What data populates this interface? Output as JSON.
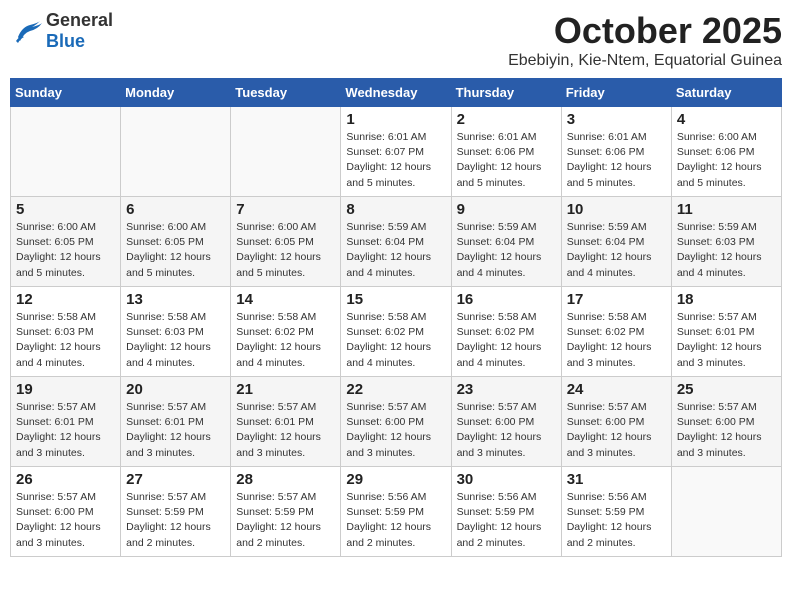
{
  "header": {
    "logo_general": "General",
    "logo_blue": "Blue",
    "month": "October 2025",
    "location": "Ebebiyin, Kie-Ntem, Equatorial Guinea"
  },
  "days_of_week": [
    "Sunday",
    "Monday",
    "Tuesday",
    "Wednesday",
    "Thursday",
    "Friday",
    "Saturday"
  ],
  "weeks": [
    [
      {
        "day": "",
        "info": ""
      },
      {
        "day": "",
        "info": ""
      },
      {
        "day": "",
        "info": ""
      },
      {
        "day": "1",
        "info": "Sunrise: 6:01 AM\nSunset: 6:07 PM\nDaylight: 12 hours\nand 5 minutes."
      },
      {
        "day": "2",
        "info": "Sunrise: 6:01 AM\nSunset: 6:06 PM\nDaylight: 12 hours\nand 5 minutes."
      },
      {
        "day": "3",
        "info": "Sunrise: 6:01 AM\nSunset: 6:06 PM\nDaylight: 12 hours\nand 5 minutes."
      },
      {
        "day": "4",
        "info": "Sunrise: 6:00 AM\nSunset: 6:06 PM\nDaylight: 12 hours\nand 5 minutes."
      }
    ],
    [
      {
        "day": "5",
        "info": "Sunrise: 6:00 AM\nSunset: 6:05 PM\nDaylight: 12 hours\nand 5 minutes."
      },
      {
        "day": "6",
        "info": "Sunrise: 6:00 AM\nSunset: 6:05 PM\nDaylight: 12 hours\nand 5 minutes."
      },
      {
        "day": "7",
        "info": "Sunrise: 6:00 AM\nSunset: 6:05 PM\nDaylight: 12 hours\nand 5 minutes."
      },
      {
        "day": "8",
        "info": "Sunrise: 5:59 AM\nSunset: 6:04 PM\nDaylight: 12 hours\nand 4 minutes."
      },
      {
        "day": "9",
        "info": "Sunrise: 5:59 AM\nSunset: 6:04 PM\nDaylight: 12 hours\nand 4 minutes."
      },
      {
        "day": "10",
        "info": "Sunrise: 5:59 AM\nSunset: 6:04 PM\nDaylight: 12 hours\nand 4 minutes."
      },
      {
        "day": "11",
        "info": "Sunrise: 5:59 AM\nSunset: 6:03 PM\nDaylight: 12 hours\nand 4 minutes."
      }
    ],
    [
      {
        "day": "12",
        "info": "Sunrise: 5:58 AM\nSunset: 6:03 PM\nDaylight: 12 hours\nand 4 minutes."
      },
      {
        "day": "13",
        "info": "Sunrise: 5:58 AM\nSunset: 6:03 PM\nDaylight: 12 hours\nand 4 minutes."
      },
      {
        "day": "14",
        "info": "Sunrise: 5:58 AM\nSunset: 6:02 PM\nDaylight: 12 hours\nand 4 minutes."
      },
      {
        "day": "15",
        "info": "Sunrise: 5:58 AM\nSunset: 6:02 PM\nDaylight: 12 hours\nand 4 minutes."
      },
      {
        "day": "16",
        "info": "Sunrise: 5:58 AM\nSunset: 6:02 PM\nDaylight: 12 hours\nand 4 minutes."
      },
      {
        "day": "17",
        "info": "Sunrise: 5:58 AM\nSunset: 6:02 PM\nDaylight: 12 hours\nand 3 minutes."
      },
      {
        "day": "18",
        "info": "Sunrise: 5:57 AM\nSunset: 6:01 PM\nDaylight: 12 hours\nand 3 minutes."
      }
    ],
    [
      {
        "day": "19",
        "info": "Sunrise: 5:57 AM\nSunset: 6:01 PM\nDaylight: 12 hours\nand 3 minutes."
      },
      {
        "day": "20",
        "info": "Sunrise: 5:57 AM\nSunset: 6:01 PM\nDaylight: 12 hours\nand 3 minutes."
      },
      {
        "day": "21",
        "info": "Sunrise: 5:57 AM\nSunset: 6:01 PM\nDaylight: 12 hours\nand 3 minutes."
      },
      {
        "day": "22",
        "info": "Sunrise: 5:57 AM\nSunset: 6:00 PM\nDaylight: 12 hours\nand 3 minutes."
      },
      {
        "day": "23",
        "info": "Sunrise: 5:57 AM\nSunset: 6:00 PM\nDaylight: 12 hours\nand 3 minutes."
      },
      {
        "day": "24",
        "info": "Sunrise: 5:57 AM\nSunset: 6:00 PM\nDaylight: 12 hours\nand 3 minutes."
      },
      {
        "day": "25",
        "info": "Sunrise: 5:57 AM\nSunset: 6:00 PM\nDaylight: 12 hours\nand 3 minutes."
      }
    ],
    [
      {
        "day": "26",
        "info": "Sunrise: 5:57 AM\nSunset: 6:00 PM\nDaylight: 12 hours\nand 3 minutes."
      },
      {
        "day": "27",
        "info": "Sunrise: 5:57 AM\nSunset: 5:59 PM\nDaylight: 12 hours\nand 2 minutes."
      },
      {
        "day": "28",
        "info": "Sunrise: 5:57 AM\nSunset: 5:59 PM\nDaylight: 12 hours\nand 2 minutes."
      },
      {
        "day": "29",
        "info": "Sunrise: 5:56 AM\nSunset: 5:59 PM\nDaylight: 12 hours\nand 2 minutes."
      },
      {
        "day": "30",
        "info": "Sunrise: 5:56 AM\nSunset: 5:59 PM\nDaylight: 12 hours\nand 2 minutes."
      },
      {
        "day": "31",
        "info": "Sunrise: 5:56 AM\nSunset: 5:59 PM\nDaylight: 12 hours\nand 2 minutes."
      },
      {
        "day": "",
        "info": ""
      }
    ]
  ]
}
